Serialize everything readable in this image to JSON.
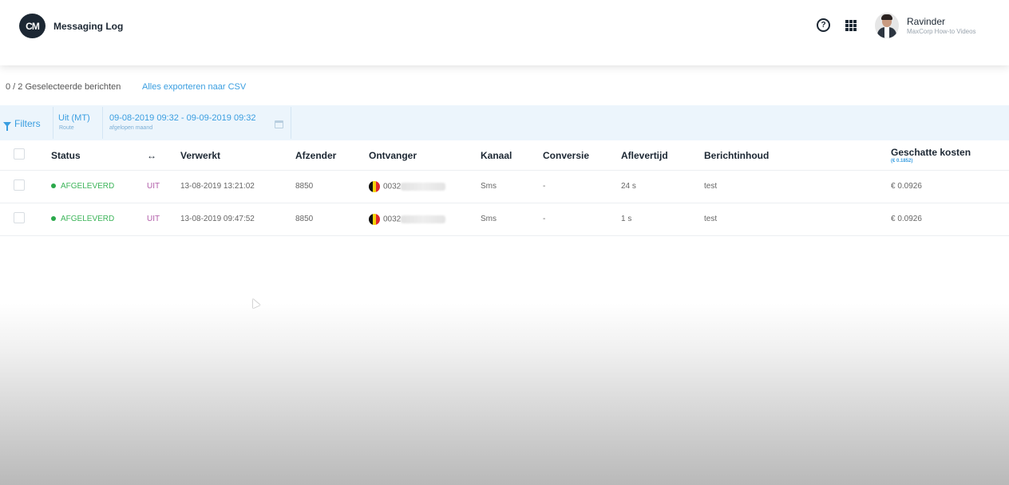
{
  "header": {
    "logo_text": "CM",
    "app_title": "Messaging Log",
    "user_name": "Ravinder",
    "user_org": "MaxCorp How-to Videos"
  },
  "toolbar": {
    "selected_count": "0 / 2 Geselecteerde berichten",
    "export_link": "Alles exporteren naar CSV"
  },
  "filters": {
    "label": "Filters",
    "route_value": "Uit (MT)",
    "route_sub": "Route",
    "date_value": "09-08-2019 09:32 - 09-09-2019 09:32",
    "date_sub": "afgelopen maand"
  },
  "table": {
    "columns": {
      "status": "Status",
      "direction": "↔",
      "processed": "Verwerkt",
      "sender": "Afzender",
      "recipient": "Ontvanger",
      "channel": "Kanaal",
      "conversion": "Conversie",
      "delivery_time": "Aflevertijd",
      "content": "Berichtinhoud",
      "cost": "Geschatte kosten",
      "cost_total": "(€ 0.1852)"
    },
    "rows": [
      {
        "status": "AFGELEVERD",
        "direction": "UIT",
        "processed": "13-08-2019 13:21:02",
        "sender": "8850",
        "recipient": "0032",
        "channel": "Sms",
        "conversion": "-",
        "delivery_time": "24 s",
        "content": "test",
        "cost": "€ 0.0926"
      },
      {
        "status": "AFGELEVERD",
        "direction": "UIT",
        "processed": "13-08-2019 09:47:52",
        "sender": "8850",
        "recipient": "0032",
        "channel": "Sms",
        "conversion": "-",
        "delivery_time": "1 s",
        "content": "test",
        "cost": "€ 0.0926"
      }
    ]
  },
  "colors": {
    "accent": "#3a9ee0",
    "status_delivered": "#2aa84a",
    "direction": "#b05ca8",
    "brand_dark": "#1c2733"
  },
  "icons": {
    "help": "question-circle",
    "apps": "grid",
    "filter": "funnel",
    "calendar": "calendar",
    "recipient_flag": "belgium-flag"
  }
}
